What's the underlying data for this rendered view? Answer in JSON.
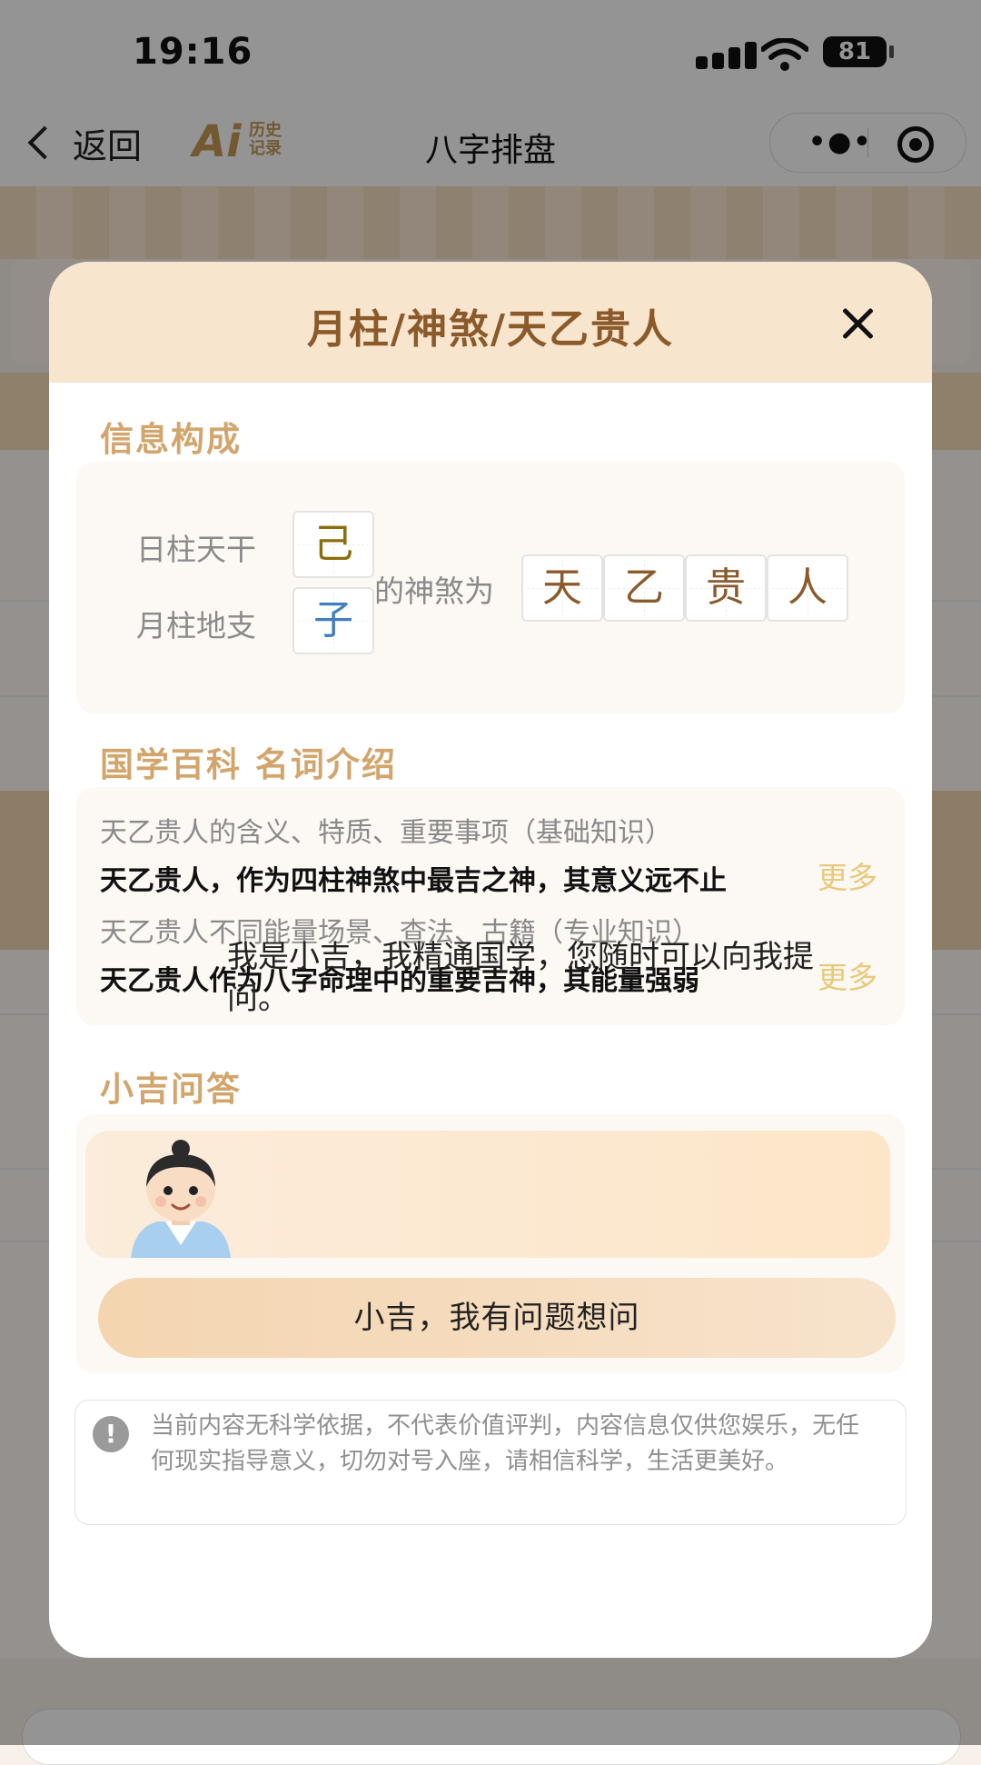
{
  "status": {
    "time": "19:16",
    "battery": "81"
  },
  "nav": {
    "back_label": "返回",
    "logo_big": "Ai",
    "logo_small": "历史记录",
    "title": "八字排盘"
  },
  "modal": {
    "title": "月柱/神煞/天乙贵人",
    "info_title": "信息构成",
    "rows": [
      {
        "label": "日柱天干",
        "char": "己",
        "color": "#8b6d0a"
      },
      {
        "label": "月柱地支",
        "char": "子",
        "color": "#3f7fc0"
      }
    ],
    "connector": "的神煞为",
    "result_chars": [
      "天",
      "乙",
      "贵",
      "人"
    ],
    "ency_title": "国学百科 名词介绍",
    "ency_items": [
      {
        "subtitle": "天乙贵人的含义、特质、重要事项（基础知识）",
        "text": "天乙贵人，作为四柱神煞中最吉之神，其意义远不止",
        "more": "更多"
      },
      {
        "subtitle": "天乙贵人不同能量场景、查法、古籍（专业知识）",
        "text": "天乙贵人作为八字命理中的重要吉神，其能量强弱",
        "more": "更多"
      }
    ],
    "qa_title": "小吉问答",
    "qa_text": "我是小吉，我精通国学，您随时可以向我提问。",
    "ask_button": "小吉，我有问题想问",
    "disclaimer": "当前内容无科学依据，不代表价值评判，内容信息仅供您娱乐，无任何现实指导意义，切勿对号入座，请相信科学，生活更美好。",
    "disclaimer_icon": "!"
  },
  "colors": {
    "accent": "#d2a56c",
    "title_brown": "#8b5a2b",
    "more_gold": "#e9c97a",
    "header_bg": "#f8e5ce"
  }
}
